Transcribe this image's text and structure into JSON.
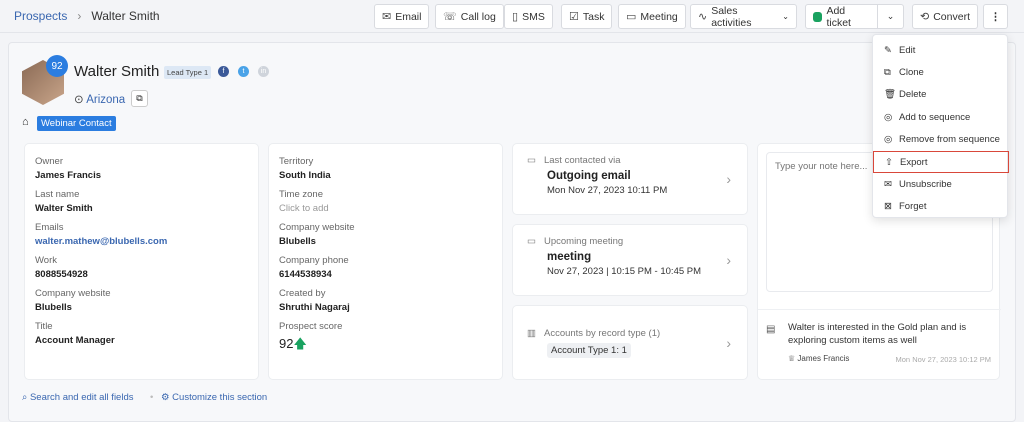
{
  "breadcrumb": {
    "parent": "Prospects",
    "current": "Walter Smith"
  },
  "toolbar": {
    "email": "Email",
    "call_log": "Call log",
    "sms": "SMS",
    "task": "Task",
    "meeting": "Meeting",
    "sales_activities": "Sales activities",
    "add_ticket": "Add ticket",
    "convert": "Convert"
  },
  "profile": {
    "score": "92",
    "name": "Walter Smith",
    "lead_type": "Lead Type 1",
    "location": "Arizona",
    "tag": "Webinar Contact"
  },
  "fields_left": [
    {
      "label": "Owner",
      "value": "James Francis"
    },
    {
      "label": "Last name",
      "value": "Walter Smith"
    },
    {
      "label": "Emails",
      "value": "walter.mathew@blubells.com"
    },
    {
      "label": "Work",
      "value": "8088554928"
    },
    {
      "label": "Company website",
      "value": "Blubells"
    },
    {
      "label": "Title",
      "value": "Account Manager"
    }
  ],
  "fields_right": [
    {
      "label": "Territory",
      "value": "South India"
    },
    {
      "label": "Time zone",
      "value": "Click to add"
    },
    {
      "label": "Company website",
      "value": "Blubells"
    },
    {
      "label": "Company phone",
      "value": "6144538934"
    },
    {
      "label": "Created by",
      "value": "Shruthi Nagaraj"
    },
    {
      "label": "Prospect score",
      "value": "92"
    }
  ],
  "last_contacted": {
    "label": "Last contacted via",
    "title": "Outgoing email",
    "sub": "Mon Nov 27, 2023 10:11 PM"
  },
  "upcoming": {
    "label": "Upcoming meeting",
    "title": "meeting",
    "sub": "Nov 27, 2023 | 10:15 PM - 10:45 PM"
  },
  "accounts": {
    "label": "Accounts by record type (1)",
    "chip": "Account Type 1: 1"
  },
  "notes": {
    "placeholder": "Type your note here...",
    "text": "Walter is interested in the Gold plan and is exploring custom items as well",
    "author": "James Francis",
    "time": "Mon Nov 27, 2023 10:12 PM"
  },
  "menu": [
    {
      "label": "Edit",
      "icon": "✎"
    },
    {
      "label": "Clone",
      "icon": "⧉"
    },
    {
      "label": "Delete",
      "icon": "🗑"
    },
    {
      "label": "Add to sequence",
      "icon": "◎"
    },
    {
      "label": "Remove from sequence",
      "icon": "◎"
    },
    {
      "label": "Export",
      "icon": "⇧"
    },
    {
      "label": "Unsubscribe",
      "icon": "✉"
    },
    {
      "label": "Forget",
      "icon": "⊠"
    }
  ],
  "footer": {
    "search": "Search and edit all fields",
    "customize": "Customize this section"
  },
  "colors": {
    "accent": "#2b7de0",
    "link": "#3a67b0",
    "highlight": "#d9473a",
    "score_up": "#1aa260"
  }
}
